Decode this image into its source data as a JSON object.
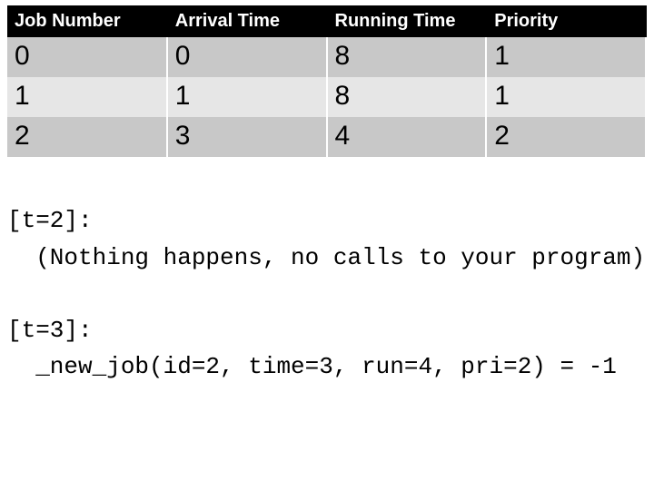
{
  "table": {
    "headers": [
      "Job Number",
      "Arrival Time",
      "Running Time",
      "Priority"
    ],
    "rows": [
      {
        "job": "0",
        "arrival": "0",
        "running": "8",
        "priority": "1"
      },
      {
        "job": "1",
        "arrival": "1",
        "running": "8",
        "priority": "1"
      },
      {
        "job": "2",
        "arrival": "3",
        "running": "4",
        "priority": "2"
      }
    ]
  },
  "trace": {
    "t2_label": "[t=2]:",
    "t2_note": "  (Nothing happens, no calls to your program)",
    "blank": "",
    "t3_label": "[t=3]:",
    "t3_call": "  _new_job(id=2, time=3, run=4, pri=2) = -1"
  }
}
